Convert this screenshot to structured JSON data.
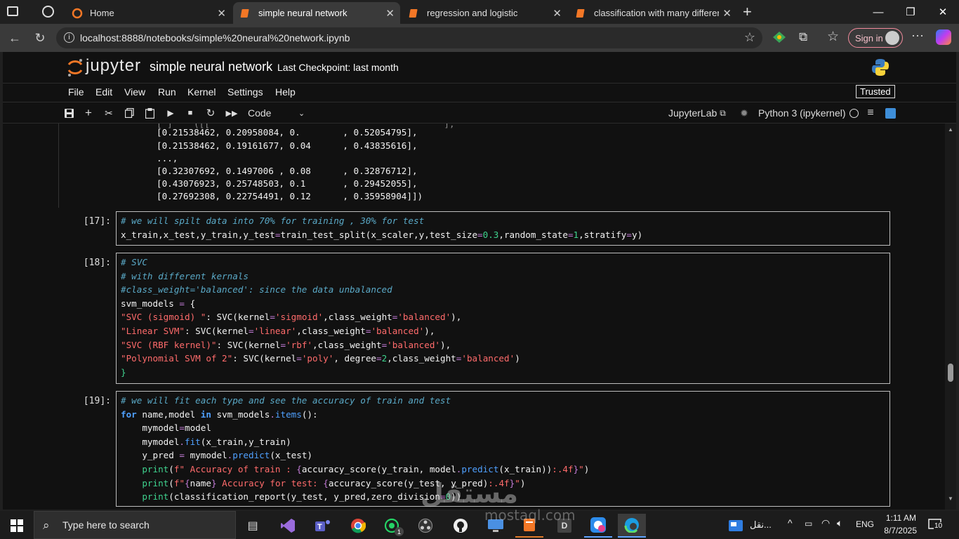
{
  "browser": {
    "tabs": [
      {
        "label": "Home"
      },
      {
        "label": "simple neural network"
      },
      {
        "label": "regression and logistic"
      },
      {
        "label": "classification with many different"
      }
    ],
    "url": "localhost:8888/notebooks/simple%20neural%20network.ipynb",
    "signin_label": "Sign in"
  },
  "jupyter": {
    "logo_text": "jupyter",
    "notebook_title": "simple neural network",
    "checkpoint": "Last Checkpoint: last month",
    "menu": [
      "File",
      "Edit",
      "View",
      "Run",
      "Kernel",
      "Settings",
      "Help"
    ],
    "trusted": "Trusted",
    "cell_type": "Code",
    "jupyterlab_link": "JupyterLab",
    "kernel": "Python 3 (ipykernel)"
  },
  "output_lines": [
    "[0.21538462, 0.20958084, 0.        , 0.52054795],",
    "[0.21538462, 0.19161677, 0.04      , 0.43835616],",
    "...,",
    "[0.32307692, 0.1497006 , 0.08      , 0.32876712],",
    "[0.43076923, 0.25748503, 0.1       , 0.29452055],",
    "[0.27692308, 0.22754491, 0.12      , 0.35958904]])"
  ],
  "cells": [
    {
      "prompt": "[17]:"
    },
    {
      "prompt": "[18]:"
    },
    {
      "prompt": "[19]:"
    }
  ],
  "code": {
    "c17_l1": "# we will spilt data into 70% for training , 30% for test",
    "c17_l2_a": "x_train,x_test,y_train,y_test",
    "c17_l2_b": "=",
    "c17_l2_c": "train_test_split(x_scaler,y,test_size",
    "c17_l2_d": "=",
    "c17_l2_e": "0.3",
    "c17_l2_f": ",random_state",
    "c17_l2_g": "=",
    "c17_l2_h": "1",
    "c17_l2_i": ",stratify",
    "c17_l2_j": "=",
    "c17_l2_k": "y)",
    "c18_l1": "# SVC",
    "c18_l2": "# with different kernals",
    "c18_l3": "#class_weight='balanced': since the data unbalanced",
    "c18_l4_a": "svm_models ",
    "c18_l4_b": "=",
    "c18_l4_c": " {",
    "c18_l5_a": "\"SVC (sigmoid) \"",
    "c18_l5_b": ": SVC(kernel",
    "c18_l5_c": "=",
    "c18_l5_d": "'sigmoid'",
    "c18_l5_e": ",class_weight",
    "c18_l5_f": "=",
    "c18_l5_g": "'balanced'",
    "c18_l5_h": "),",
    "c18_l6_a": "\"Linear SVM\"",
    "c18_l6_b": ": SVC(kernel",
    "c18_l6_c": "=",
    "c18_l6_d": "'linear'",
    "c18_l6_e": ",class_weight",
    "c18_l6_f": "=",
    "c18_l6_g": "'balanced'",
    "c18_l6_h": "),",
    "c18_l7_a": "\"SVC (RBF kernel)\"",
    "c18_l7_b": ": SVC(kernel",
    "c18_l7_c": "=",
    "c18_l7_d": "'rbf'",
    "c18_l7_e": ",class_weight",
    "c18_l7_f": "=",
    "c18_l7_g": "'balanced'",
    "c18_l7_h": "),",
    "c18_l8_a": "\"Polynomial SVM of 2\"",
    "c18_l8_b": ": SVC(kernel",
    "c18_l8_c": "=",
    "c18_l8_d": "'poly'",
    "c18_l8_e": ", degree",
    "c18_l8_f": "=",
    "c18_l8_g": "2",
    "c18_l8_h": ",class_weight",
    "c18_l8_i": "=",
    "c18_l8_j": "'balanced'",
    "c18_l8_k": ")",
    "c18_l9": "}",
    "c19_l1": "# we will fit each type and see the accuracy of train and test",
    "c19_l2_a": "for",
    "c19_l2_b": " name,model ",
    "c19_l2_c": "in",
    "c19_l2_d": " svm_models",
    "c19_l2_e": ".",
    "c19_l2_f": "items",
    "c19_l2_g": "():",
    "c19_l3_a": "    mymodel",
    "c19_l3_b": "=",
    "c19_l3_c": "model",
    "c19_l4_a": "    mymodel",
    "c19_l4_b": ".",
    "c19_l4_c": "fit",
    "c19_l4_d": "(x_train,y_train)",
    "c19_l5_a": "    y_pred ",
    "c19_l5_b": "=",
    "c19_l5_c": " mymodel",
    "c19_l5_d": ".",
    "c19_l5_e": "predict",
    "c19_l5_f": "(x_test)",
    "c19_l6_a": "    ",
    "c19_l6_b": "print",
    "c19_l6_c": "(",
    "c19_l6_d": "f\" Accuracy of train : ",
    "c19_l6_e": "{",
    "c19_l6_f": "accuracy_score(y_train, model",
    "c19_l6_g": ".",
    "c19_l6_h": "predict",
    "c19_l6_i": "(x_train))",
    "c19_l6_j": ":.4f",
    "c19_l6_k": "}",
    "c19_l6_l": "\"",
    "c19_l6_m": ")",
    "c19_l7_a": "    ",
    "c19_l7_b": "print",
    "c19_l7_c": "(",
    "c19_l7_d": "f\"",
    "c19_l7_e": "{",
    "c19_l7_f": "name",
    "c19_l7_g": "}",
    "c19_l7_h": " Accuracy for test: ",
    "c19_l7_i": "{",
    "c19_l7_j": "accuracy_score(y_test, y_pred)",
    "c19_l7_k": ":.4f",
    "c19_l7_l": "}",
    "c19_l7_m": "\"",
    "c19_l7_n": ")",
    "c19_l8_a": "    ",
    "c19_l8_b": "print",
    "c19_l8_c": "(classification_report(y_test, y_pred,zero_division",
    "c19_l8_d": "=",
    "c19_l8_e": "0",
    "c19_l8_f": "))"
  },
  "taskbar": {
    "search_placeholder": "Type here to search",
    "tray_text": "نقل...",
    "language": "ENG",
    "time": "1:11 AM",
    "date": "8/7/2025",
    "notifications": "10",
    "whatsapp_badge": "1",
    "d_app_label": "D"
  },
  "watermark": {
    "line1": "مستقل",
    "line2": "mostaql.com"
  }
}
